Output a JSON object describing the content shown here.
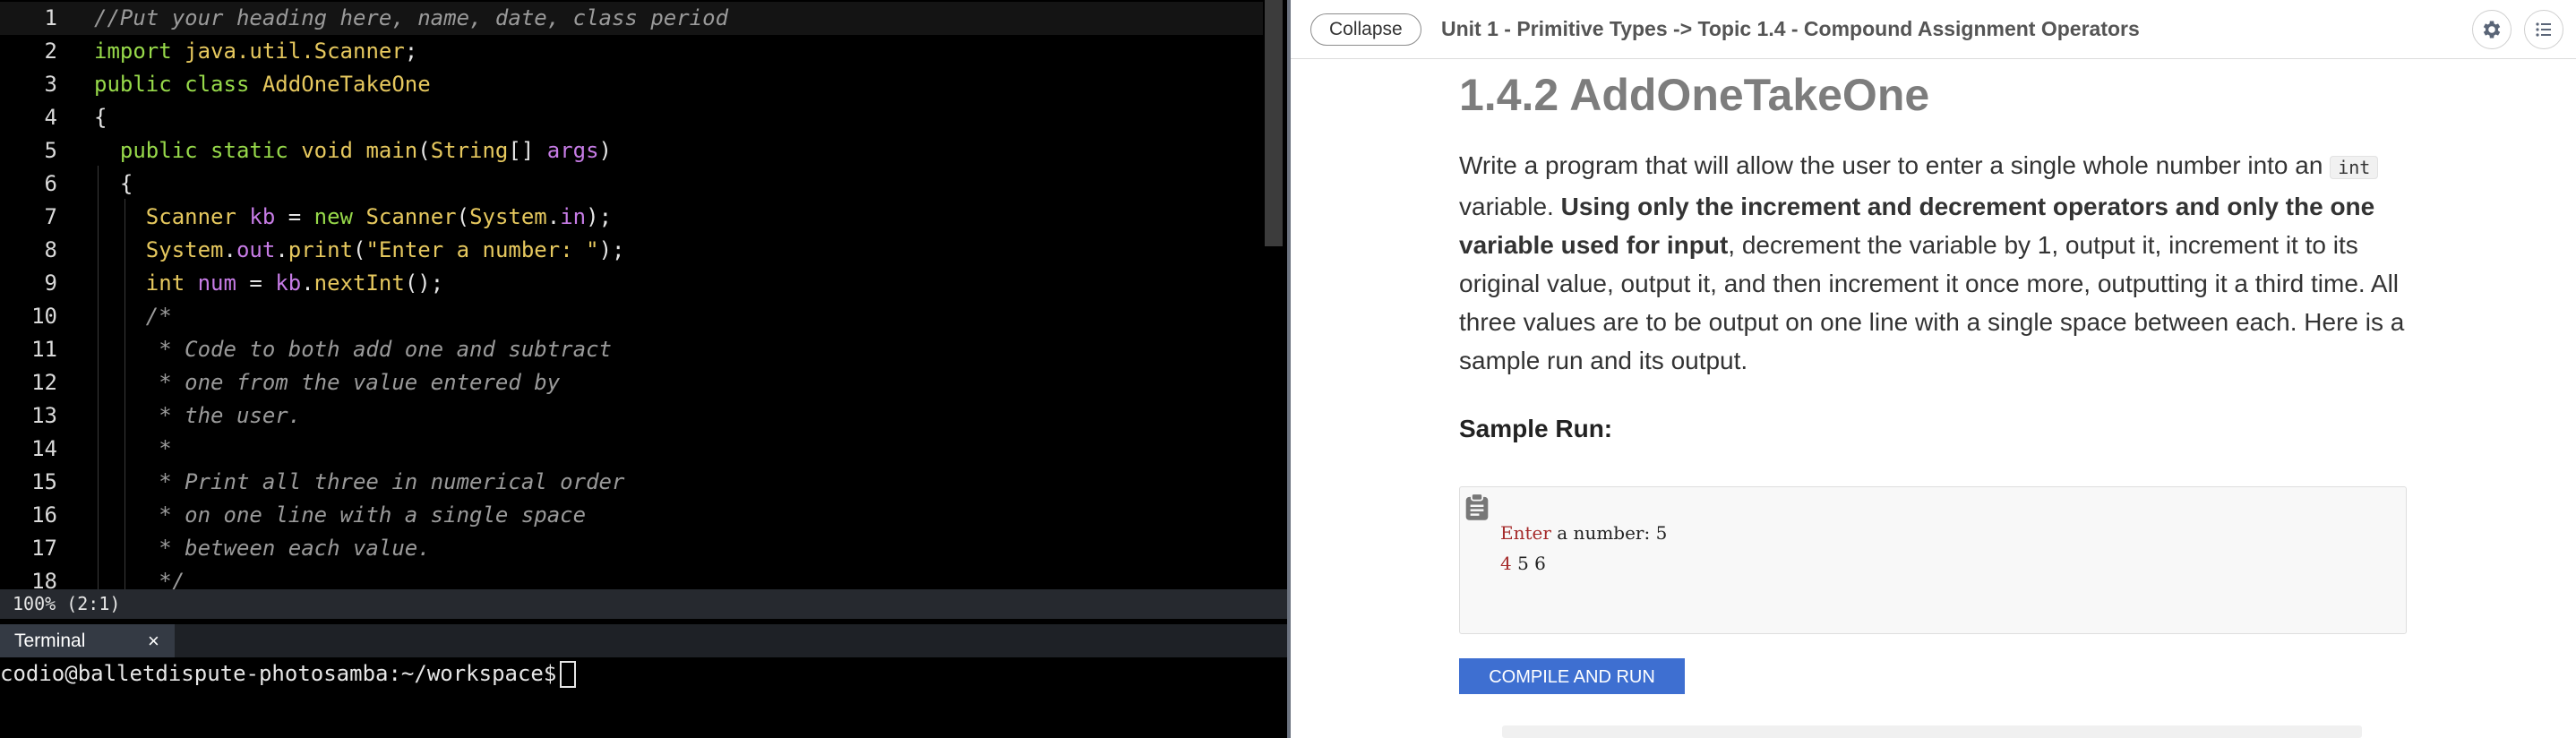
{
  "editor": {
    "lines": [
      {
        "n": "1",
        "current": true,
        "tokens": [
          {
            "t": "//Put your heading here, name, date, class period",
            "c": "comment"
          }
        ]
      },
      {
        "n": "2",
        "tokens": [
          {
            "t": "import ",
            "c": "kw"
          },
          {
            "t": "java.util.Scanner",
            "c": "type"
          },
          {
            "t": ";",
            "c": "plain"
          }
        ]
      },
      {
        "n": "3",
        "tokens": [
          {
            "t": "public class ",
            "c": "kw"
          },
          {
            "t": "AddOneTakeOne",
            "c": "type"
          }
        ]
      },
      {
        "n": "4",
        "tokens": [
          {
            "t": "{",
            "c": "plain"
          }
        ]
      },
      {
        "n": "5",
        "tokens": [
          {
            "t": "  public static ",
            "c": "kw"
          },
          {
            "t": "void ",
            "c": "type"
          },
          {
            "t": "main",
            "c": "fn"
          },
          {
            "t": "(",
            "c": "plain"
          },
          {
            "t": "String",
            "c": "type"
          },
          {
            "t": "[] ",
            "c": "plain"
          },
          {
            "t": "args",
            "c": "var"
          },
          {
            "t": ")",
            "c": "plain"
          }
        ]
      },
      {
        "n": "6",
        "tokens": [
          {
            "t": "  {",
            "c": "plain"
          }
        ]
      },
      {
        "n": "7",
        "tokens": [
          {
            "t": "    Scanner ",
            "c": "type"
          },
          {
            "t": "kb",
            "c": "var"
          },
          {
            "t": " = ",
            "c": "plain"
          },
          {
            "t": "new ",
            "c": "kw"
          },
          {
            "t": "Scanner",
            "c": "type"
          },
          {
            "t": "(",
            "c": "plain"
          },
          {
            "t": "System",
            "c": "type"
          },
          {
            "t": ".",
            "c": "plain"
          },
          {
            "t": "in",
            "c": "var"
          },
          {
            "t": ");",
            "c": "plain"
          }
        ]
      },
      {
        "n": "8",
        "tokens": [
          {
            "t": "    System",
            "c": "type"
          },
          {
            "t": ".",
            "c": "plain"
          },
          {
            "t": "out",
            "c": "var"
          },
          {
            "t": ".",
            "c": "plain"
          },
          {
            "t": "print",
            "c": "fn"
          },
          {
            "t": "(",
            "c": "plain"
          },
          {
            "t": "\"Enter a number: \"",
            "c": "str"
          },
          {
            "t": ");",
            "c": "plain"
          }
        ]
      },
      {
        "n": "9",
        "tokens": [
          {
            "t": "    int ",
            "c": "type"
          },
          {
            "t": "num",
            "c": "var"
          },
          {
            "t": " = ",
            "c": "plain"
          },
          {
            "t": "kb",
            "c": "var"
          },
          {
            "t": ".",
            "c": "plain"
          },
          {
            "t": "nextInt",
            "c": "fn"
          },
          {
            "t": "();",
            "c": "plain"
          }
        ]
      },
      {
        "n": "10",
        "tokens": [
          {
            "t": "    /*",
            "c": "comment"
          }
        ]
      },
      {
        "n": "11",
        "tokens": [
          {
            "t": "     * Code to both add one and subtract",
            "c": "comment"
          }
        ]
      },
      {
        "n": "12",
        "tokens": [
          {
            "t": "     * one from the value entered by",
            "c": "comment"
          }
        ]
      },
      {
        "n": "13",
        "tokens": [
          {
            "t": "     * the user.",
            "c": "comment"
          }
        ]
      },
      {
        "n": "14",
        "tokens": [
          {
            "t": "     *",
            "c": "comment"
          }
        ]
      },
      {
        "n": "15",
        "tokens": [
          {
            "t": "     * Print all three in numerical order",
            "c": "comment"
          }
        ]
      },
      {
        "n": "16",
        "tokens": [
          {
            "t": "     * on one line with a single space",
            "c": "comment"
          }
        ]
      },
      {
        "n": "17",
        "tokens": [
          {
            "t": "     * between each value.",
            "c": "comment"
          }
        ]
      },
      {
        "n": "18",
        "tokens": [
          {
            "t": "     */",
            "c": "comment"
          }
        ]
      }
    ],
    "status": "100%  (2:1)"
  },
  "terminal": {
    "tab_label": "Terminal",
    "close_glyph": "×",
    "prompt": "codio@balletdispute-photosamba:~/workspace$"
  },
  "guide": {
    "collapse_label": "Collapse",
    "breadcrumb": "Unit 1 - Primitive Types -> Topic 1.4 - Compound Assignment Operators",
    "title": "1.4.2 AddOneTakeOne",
    "para": {
      "p1": "Write a program that will allow the user to enter a single whole number into an ",
      "code": "int",
      "p2": " variable. ",
      "bold": "Using only the increment and decrement operators and only the one variable used for input",
      "p3": ", decrement the variable by 1, output it, increment it to its original value, output it, and then increment it once more, outputting it a third time. All three values are to be output on one line with a single space between each. Here is a sample run and its output."
    },
    "sample_heading": "Sample Run:",
    "sample": {
      "line1_red": "Enter",
      "line1_rest": " a number: 5",
      "line2_red": "4",
      "line2_rest": " 5 6"
    },
    "compile_label": "COMPILE AND RUN"
  },
  "colors": {
    "accent_button": "#3e6fd1",
    "editor_bg": "#000000",
    "keyword": "#97d94a",
    "type": "#e6c85e",
    "variable": "#c77ce6",
    "comment": "#9a9a9a"
  },
  "icons": [
    "gear-icon",
    "list-icon",
    "clipboard-icon",
    "close-icon"
  ]
}
